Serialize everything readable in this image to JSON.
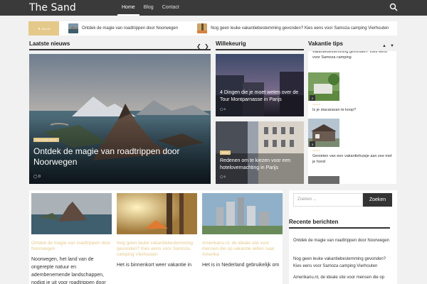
{
  "header": {
    "site_title": "The Sand",
    "nav": [
      {
        "label": "Home",
        "active": true
      },
      {
        "label": "Blog",
        "active": false
      },
      {
        "label": "Contact",
        "active": false
      }
    ],
    "search_icon": "search-icon"
  },
  "ticker": {
    "badge_label": "Net uit",
    "items": [
      {
        "text": "Ontdek de magie van roadtrippen door Noorwegen"
      },
      {
        "text": "Nog geen leuke vakantiebestemming gevonden? Kies eens voor Samoza camping Vierhouten"
      }
    ]
  },
  "sections": {
    "latest": "Laatste nieuws",
    "random": "Willekeurig",
    "tips": "Vakantie tips",
    "recent": "Recente berichten"
  },
  "hero": {
    "tag": "Gesponsorde artikelen",
    "title": "Ontdek de magie van roadtrippen door Noorwegen",
    "comments": "0"
  },
  "random_cards": [
    {
      "tag": "",
      "title": "4 Dingen die je moet weten over de Tour Montparnasse in Parijs",
      "comments": "0"
    },
    {
      "tag": "Reizen",
      "title": "Redenen om te kiezen voor een hotelovernachting in Parijs",
      "comments": "0"
    }
  ],
  "tips": [
    {
      "num": "",
      "tag": "",
      "title": "vakantiebestemming gevonden? Kies eens voor Samoza camping"
    },
    {
      "num": "2",
      "tag": "Vakantie",
      "title": "Is je stacaravan te koop?"
    },
    {
      "num": "3",
      "tag": "Vakantie",
      "title": "Genieten van een vakantiehuisje aan zee met je hond"
    }
  ],
  "posts": [
    {
      "title": "Ontdek de magie van roadtrippen door Noorwegen",
      "excerpt": "Noorwegen, het land van de ongerepte natuur en adembenemende landschappen, nodigt je uit voor roadtrippen door"
    },
    {
      "title": "Nog geen leuke vakantiebestemming gevonden? Kies eens voor Samoza camping Vierhouten",
      "excerpt": "Het is binnenkort weer vakantie in"
    },
    {
      "title": "Amerikanu.nl, de ideale site voor mensen die op vakantie willen naar Amerika",
      "excerpt": "Het is in Nederland gebruikelijk om"
    }
  ],
  "sidebar": {
    "search_placeholder": "Zoeken ...",
    "search_button": "Zoeken",
    "recent": [
      "Ontdek de magie van roadtrippen door Noorwegen",
      "Nog geen leuke vakantiebestemming gevonden? Kies eens voor Samoza camping Vierhouten",
      "Amerikanu.nl, de ideale site voor mensen die op"
    ]
  }
}
